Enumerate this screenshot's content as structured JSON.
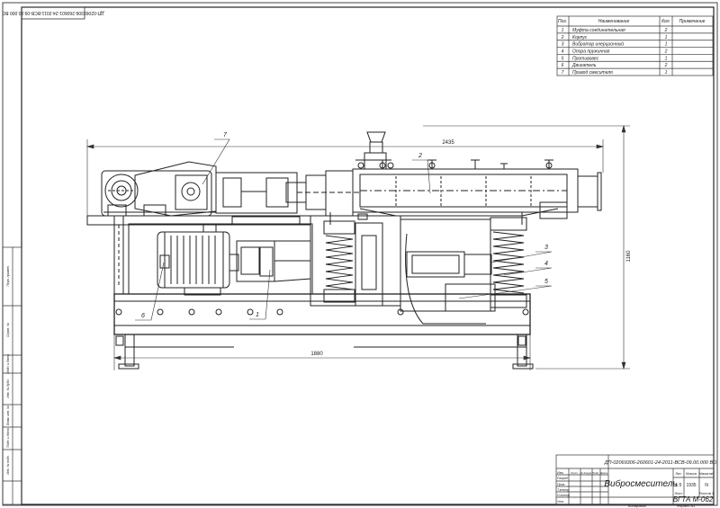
{
  "drawing": {
    "top_stamp": "ДП-02069306-260601-24-2011-ВСВ-09.00.000 ВО",
    "title": "Вибросмеситель",
    "institution": "ВГТА М-062",
    "scale": "1:5",
    "mass": "1935",
    "letter": "N",
    "sheet": "Лист",
    "sheets": "Листов 1",
    "copied": "Копировал",
    "format": "Формат A1",
    "reviewer_rows": [
      "Изм.",
      "Разраб.",
      "Пров.",
      "Т.контр.",
      "Н.контр.",
      "Утв."
    ],
    "reviewer_cols": [
      "Лист",
      "№ докум.",
      "Подп.",
      "Дата"
    ],
    "title_cols": [
      "Лит.",
      "Масса",
      "Масштаб"
    ],
    "side_labels": [
      "Перв. примен.",
      "Справ. №",
      "Подп. и дата",
      "Инв. № дубл.",
      "Взам. инв. №",
      "Подп. и дата",
      "Инв. № подл."
    ]
  },
  "spec_table": {
    "headers": [
      "Поз.",
      "Наименование",
      "Кол.",
      "Примечание"
    ],
    "rows": [
      [
        "1",
        "Муфта соединительная",
        "2",
        ""
      ],
      [
        "2",
        "Корпус",
        "1",
        ""
      ],
      [
        "3",
        "Вибратор инерционный",
        "1",
        ""
      ],
      [
        "4",
        "Опора пружинная",
        "2",
        ""
      ],
      [
        "5",
        "Противовес",
        "1",
        ""
      ],
      [
        "6",
        "Двигатель",
        "2",
        ""
      ],
      [
        "7",
        "Привод смесителя",
        "1",
        ""
      ]
    ]
  },
  "dimensions": {
    "overall_length": "2435",
    "base_length": "1880",
    "height": "1160"
  },
  "callouts": [
    "1",
    "2",
    "3",
    "4",
    "5",
    "6",
    "7"
  ]
}
